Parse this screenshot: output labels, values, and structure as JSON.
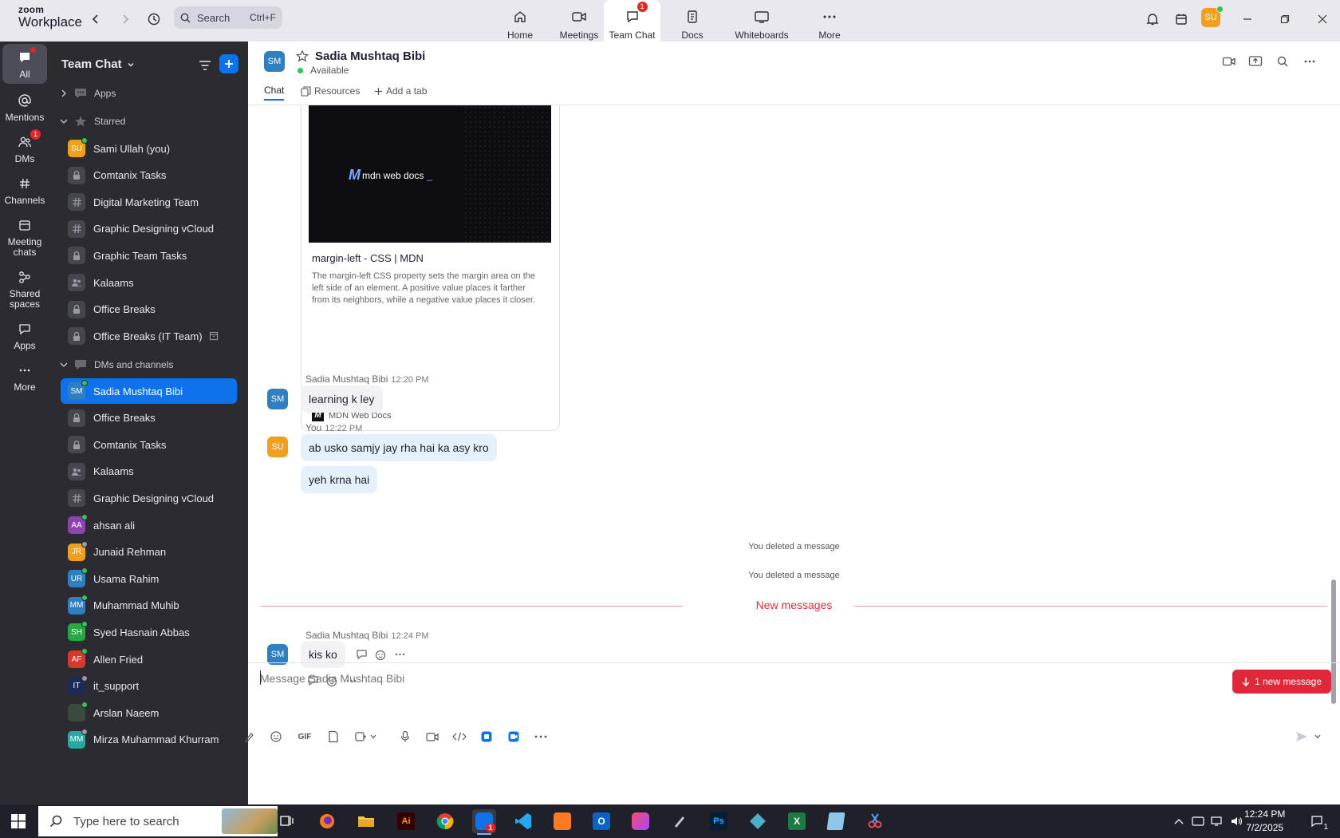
{
  "top": {
    "brand_line1": "zoom",
    "brand_line2": "Workplace",
    "search_placeholder": "Search",
    "search_shortcut": "Ctrl+F",
    "user_initials": "SU",
    "nav": [
      {
        "label": "Home",
        "icon": "home-icon"
      },
      {
        "label": "Meetings",
        "icon": "video-icon"
      },
      {
        "label": "Team Chat",
        "icon": "chat-icon",
        "badge": "1",
        "active": true
      },
      {
        "label": "Docs",
        "icon": "docs-icon"
      },
      {
        "label": "Whiteboards",
        "icon": "whiteboard-icon"
      },
      {
        "label": "More",
        "icon": "more-icon"
      }
    ]
  },
  "rail": [
    {
      "label": "All",
      "icon": "all-chat-icon",
      "active": true
    },
    {
      "label": "Mentions",
      "icon": "at-icon"
    },
    {
      "label": "DMs",
      "icon": "people-icon",
      "badge": "1"
    },
    {
      "label": "Channels",
      "icon": "hash-icon"
    },
    {
      "label": "Meeting chats",
      "icon": "calendar-icon"
    },
    {
      "label": "Shared spaces",
      "icon": "shared-icon"
    },
    {
      "label": "Apps",
      "icon": "apps-icon"
    },
    {
      "label": "More",
      "icon": "ellipsis-icon"
    }
  ],
  "sidebar": {
    "title": "Team Chat",
    "sections": {
      "apps": "Apps",
      "starred": "Starred",
      "dms": "DMs and channels"
    },
    "starred": [
      {
        "name": "Sami Ullah (you)",
        "type": "user",
        "initials": "SU",
        "color": "#f0a020",
        "presence": "#2ec55a"
      },
      {
        "name": "Comtanix Tasks",
        "type": "private"
      },
      {
        "name": "Digital Marketing Team",
        "type": "channel"
      },
      {
        "name": "Graphic Designing vCloud",
        "type": "channel"
      },
      {
        "name": "Graphic Team Tasks",
        "type": "private"
      },
      {
        "name": "Kalaams",
        "type": "group"
      },
      {
        "name": "Office Breaks",
        "type": "private"
      },
      {
        "name": "Office Breaks (IT Team)",
        "type": "private",
        "archived": true
      }
    ],
    "dms": [
      {
        "name": "Sadia Mushtaq Bibi",
        "type": "user",
        "initials": "SM",
        "color": "#2f7fc1",
        "presence": "#2ec55a",
        "active": true
      },
      {
        "name": "Office Breaks",
        "type": "private"
      },
      {
        "name": "Comtanix Tasks",
        "type": "private"
      },
      {
        "name": "Kalaams",
        "type": "group"
      },
      {
        "name": "Graphic Designing vCloud",
        "type": "channel"
      },
      {
        "name": "ahsan ali",
        "type": "user",
        "initials": "AA",
        "color": "#8e44ad",
        "presence": "#2ec55a"
      },
      {
        "name": "Junaid Rehman",
        "type": "user",
        "initials": "JR",
        "color": "#f0a020",
        "presence": "#9a9aa4"
      },
      {
        "name": "Usama Rahim",
        "type": "user",
        "initials": "UR",
        "color": "#2f7fc1",
        "presence": "#2ec55a"
      },
      {
        "name": "Muhammad Muhib",
        "type": "user",
        "initials": "MM",
        "color": "#2f7fc1",
        "presence": "#2ec55a"
      },
      {
        "name": "Syed Hasnain Abbas",
        "type": "user",
        "initials": "SH",
        "color": "#27a844",
        "presence": "#2ec55a"
      },
      {
        "name": "Allen Fried",
        "type": "user",
        "initials": "AF",
        "color": "#d33a2c",
        "presence": "#2ec55a"
      },
      {
        "name": "it_support",
        "type": "user",
        "initials": "IT",
        "color": "#1c2a5a",
        "presence": "#9a9aa4"
      },
      {
        "name": "Arslan Naeem",
        "type": "user",
        "initials": "",
        "color": "#3b4a3b",
        "presence": "#2ec55a"
      },
      {
        "name": "Mirza Muhammad Khurram",
        "type": "user",
        "initials": "MM",
        "color": "#27a8a0",
        "presence": "#9a9aa4"
      }
    ]
  },
  "chat": {
    "contact_name": "Sadia Mushtaq Bibi",
    "contact_initials": "SM",
    "status": "Available",
    "tabs": {
      "chat": "Chat",
      "resources": "Resources",
      "add": "Add a tab"
    },
    "link_card": {
      "logo_text": "mdn web docs",
      "title": "margin-left - CSS | MDN",
      "description": "The margin-left CSS property sets the margin area on the left side of an element. A positive value places it farther from its neighbors, while a negative value places it closer.",
      "source": "MDN Web Docs"
    },
    "messages": [
      {
        "sender": "Sadia Mushtaq Bibi",
        "time": "12:20 PM",
        "initials": "SM",
        "color": "#2f7fc1",
        "texts": [
          "learning k ley"
        ]
      },
      {
        "sender": "You",
        "time": "12:22 PM",
        "initials": "SU",
        "color": "#f0a020",
        "texts": [
          "ab usko samjy jay rha hai ka asy kro",
          "yeh krna hai"
        ]
      }
    ],
    "system": [
      "You deleted a message",
      "You deleted a message"
    ],
    "new_messages_label": "New messages",
    "last_message": {
      "sender": "Sadia Mushtaq Bibi",
      "time": "12:24 PM",
      "initials": "SM",
      "text": "kis ko"
    },
    "new_message_button": "1 new message",
    "composer_placeholder": "Message Sadia Mushtaq Bibi",
    "gif_label": "GIF"
  },
  "taskbar": {
    "search_placeholder": "Type here to search",
    "time": "12:24 PM",
    "date": "7/2/2025",
    "notification_count": "1",
    "zoom_badge": "1"
  }
}
